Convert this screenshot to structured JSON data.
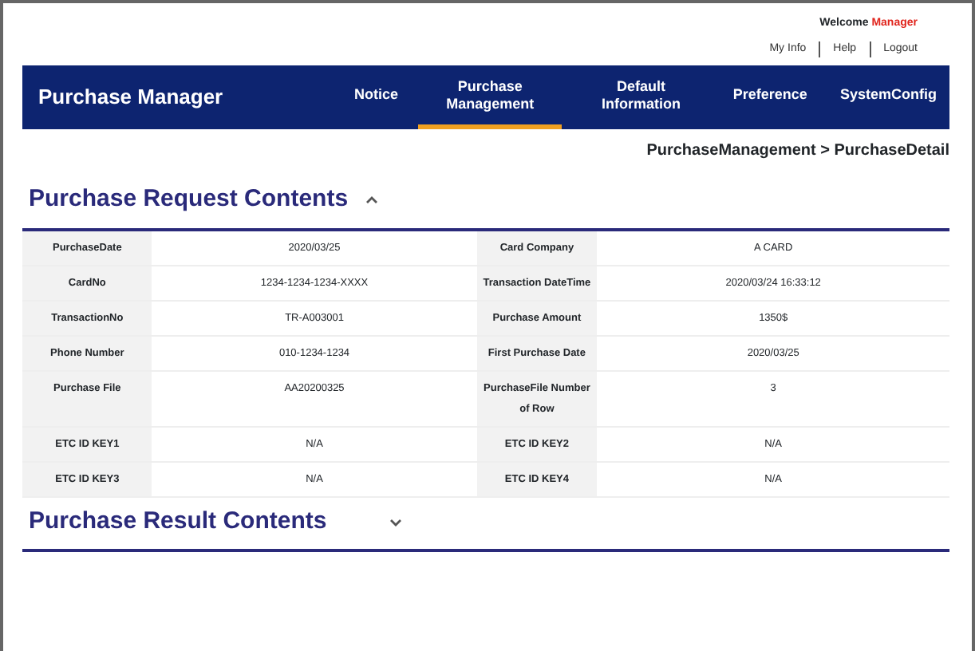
{
  "header": {
    "welcome": "Welcome",
    "user": "Manager",
    "links": [
      "My Info",
      "Help",
      "Logout"
    ]
  },
  "navbar": {
    "brand": "Purchase Manager",
    "items": [
      {
        "label": "Notice",
        "selected": false
      },
      {
        "label": "Purchase Management",
        "selected": true
      },
      {
        "label": "Default Information",
        "selected": false
      },
      {
        "label": "Preference",
        "selected": false
      },
      {
        "label": "SystemConfig",
        "selected": false
      }
    ]
  },
  "breadcrumb": "PurchaseManagement > PurchaseDetail",
  "sections": [
    {
      "title": "Purchase Request Contents",
      "expanded": true,
      "rows": [
        [
          "PurchaseDate",
          "2020/03/25",
          "Card Company",
          "A CARD"
        ],
        [
          "CardNo",
          "1234-1234-1234-XXXX",
          "Transaction DateTime",
          "2020/03/24 16:33:12"
        ],
        [
          "TransactionNo",
          "TR-A003001",
          "Purchase Amount",
          "1350$"
        ],
        [
          "Phone Number",
          "010-1234-1234",
          "First Purchase Date",
          "2020/03/25"
        ],
        [
          "Purchase File",
          "AA20200325",
          "PurchaseFile Number of Row",
          "3"
        ],
        [
          "ETC ID KEY1",
          "N/A",
          "ETC ID KEY2",
          "N/A"
        ],
        [
          "ETC ID KEY3",
          "N/A",
          "ETC ID KEY4",
          "N/A"
        ]
      ]
    },
    {
      "title": "Purchase Result Contents",
      "expanded": false
    }
  ]
}
